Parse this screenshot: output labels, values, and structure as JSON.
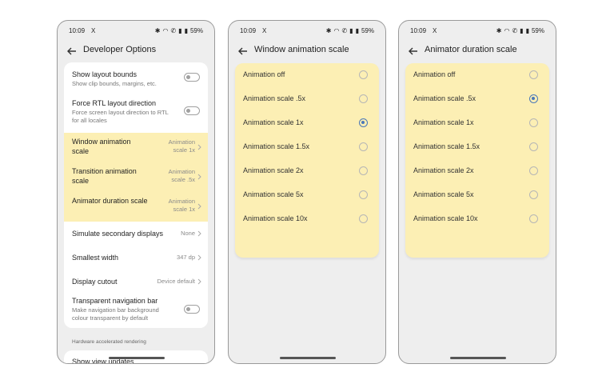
{
  "status": {
    "time": "10:09",
    "x_label": "X",
    "battery": "59%"
  },
  "screen1": {
    "title": "Developer Options",
    "items": [
      {
        "label": "Show layout bounds",
        "sub": "Show clip bounds, margins, etc."
      },
      {
        "label": "Force RTL layout direction",
        "sub": "Force screen layout direction to RTL for all locales"
      },
      {
        "label": "Window animation scale",
        "value": "Animation scale 1x"
      },
      {
        "label": "Transition animation scale",
        "value": "Animation scale .5x"
      },
      {
        "label": "Animator duration scale",
        "value": "Animation scale 1x"
      },
      {
        "label": "Simulate secondary displays",
        "value": "None"
      },
      {
        "label": "Smallest width",
        "value": "347 dp"
      },
      {
        "label": "Display cutout",
        "value": "Device default"
      },
      {
        "label": "Transparent navigation bar",
        "sub": "Make navigation bar background colour transparent by default"
      }
    ],
    "section": "Hardware accelerated rendering",
    "bottom_item": "Show view updates"
  },
  "screen2": {
    "title": "Window animation scale",
    "selected": 2,
    "options": [
      "Animation off",
      "Animation scale .5x",
      "Animation scale 1x",
      "Animation scale 1.5x",
      "Animation scale 2x",
      "Animation scale 5x",
      "Animation scale 10x"
    ]
  },
  "screen3": {
    "title": "Animator duration scale",
    "selected": 1,
    "options": [
      "Animation off",
      "Animation scale .5x",
      "Animation scale 1x",
      "Animation scale 1.5x",
      "Animation scale 2x",
      "Animation scale 5x",
      "Animation scale 10x"
    ]
  },
  "colors": {
    "highlight": "#fcefb4",
    "radio_selected": "#4a78b8",
    "phone_bg": "#eeeeee"
  }
}
